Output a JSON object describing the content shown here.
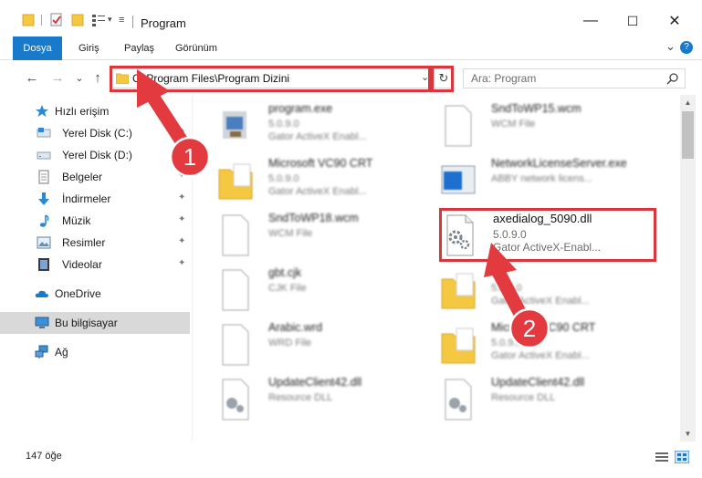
{
  "window": {
    "title": "Program",
    "minimize": "—",
    "maximize": "☐",
    "close": "✕"
  },
  "ribbon": {
    "tabs": [
      "Dosya",
      "Giriş",
      "Paylaş",
      "Görünüm"
    ],
    "expand": "⌄",
    "help": "?"
  },
  "nav": {
    "back": "←",
    "forward": "→",
    "recent": "⌄",
    "up": "↑",
    "address": "C:\\Program Files\\Program Dizini",
    "address_dropdown": "⌄",
    "refresh": "↻",
    "search_placeholder": "Ara: Program"
  },
  "sidebar": {
    "quick_access": "Hızlı erişim",
    "items": [
      {
        "label": "Yerel Disk (C:)",
        "icon": "drive-icon",
        "pinned": true
      },
      {
        "label": "Yerel Disk (D:)",
        "icon": "drive-icon",
        "pinned": false
      },
      {
        "label": "Belgeler",
        "icon": "documents-icon",
        "pinned": true
      },
      {
        "label": "İndirmeler",
        "icon": "download-icon",
        "pinned": true
      },
      {
        "label": "Müzik",
        "icon": "music-icon",
        "pinned": true
      },
      {
        "label": "Resimler",
        "icon": "pictures-icon",
        "pinned": true
      },
      {
        "label": "Videolar",
        "icon": "videos-icon",
        "pinned": true
      }
    ],
    "onedrive": "OneDrive",
    "this_pc": "Bu bilgisayar",
    "network": "Ağ",
    "pin_glyph": "📌"
  },
  "files": {
    "left": [
      {
        "name": "program.exe",
        "sub1": "5.0.9.0",
        "sub2": "Gator ActiveX Enabl...",
        "icon": "exe-icon"
      },
      {
        "name": "Microsoft VC90 CRT",
        "sub1": "5.0.9.0",
        "sub2": "Gator ActiveX Enabl...",
        "icon": "folder-icon"
      },
      {
        "name": "SndToWP18.wcm",
        "sub1": "WCM File",
        "sub2": "",
        "icon": "file-icon"
      },
      {
        "name": "gbt.cjk",
        "sub1": "CJK File",
        "sub2": "",
        "icon": "file-icon"
      },
      {
        "name": "Arabic.wrd",
        "sub1": "WRD File",
        "sub2": "",
        "icon": "file-icon"
      },
      {
        "name": "UpdateClient42.dll",
        "sub1": "Resource DLL",
        "sub2": "",
        "icon": "dll-icon"
      }
    ],
    "right": [
      {
        "name": "SndToWP15.wcm",
        "sub1": "WCM File",
        "sub2": "",
        "icon": "file-icon"
      },
      {
        "name": "NetworkLicenseServer.exe",
        "sub1": "ABBY network licens...",
        "sub2": "",
        "icon": "window-icon"
      },
      {
        "name": "axedialog_5090.dll",
        "sub1": "5.0.9.0",
        "sub2": "Gator ActiveX-Enabl...",
        "icon": "dll-icon"
      },
      {
        "name": "etc",
        "sub1": "5.0.9.0",
        "sub2": "Gator ActiveX Enabl...",
        "icon": "folder-icon"
      },
      {
        "name": "Microsoft VC90 CRT",
        "sub1": "5.0.9.0",
        "sub2": "Gator ActiveX Enabl...",
        "icon": "folder-icon"
      },
      {
        "name": "UpdateClient42.dll",
        "sub1": "Resource DLL",
        "sub2": "",
        "icon": "dll-icon"
      }
    ]
  },
  "status": {
    "count": "147 öğe"
  },
  "annotations": {
    "step1": "1",
    "step2": "2",
    "color": "#d9363e"
  }
}
